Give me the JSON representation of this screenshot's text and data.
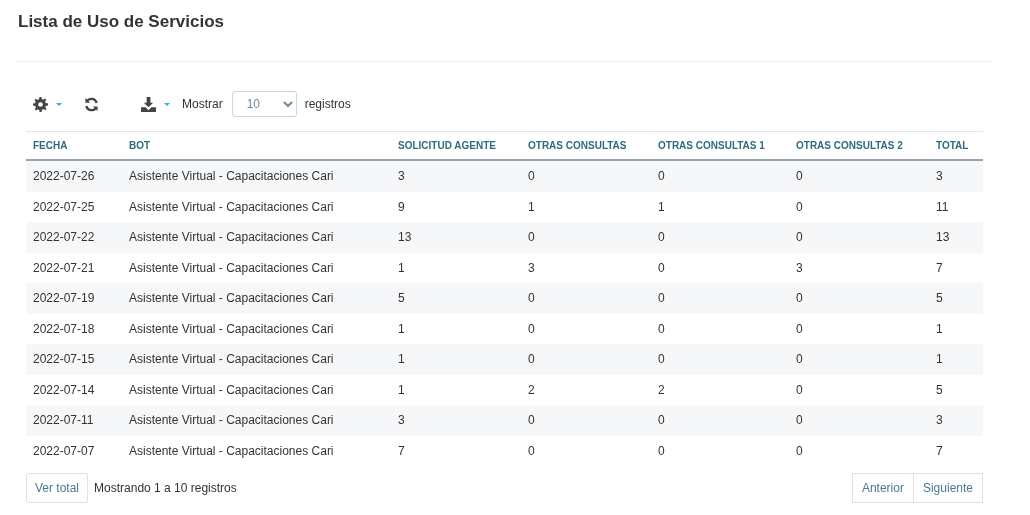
{
  "page": {
    "title": "Lista de Uso de Servicios"
  },
  "toolbar": {
    "show_label": "Mostrar",
    "page_size": "10",
    "records_label": "registros"
  },
  "table": {
    "columns": [
      "FECHA",
      "BOT",
      "SOLICITUD AGENTE",
      "OTRAS CONSULTAS",
      "OTRAS CONSULTAS 1",
      "OTRAS CONSULTAS 2",
      "TOTAL"
    ],
    "rows": [
      [
        "2022-07-26",
        "Asistente Virtual - Capacitaciones Cari",
        "3",
        "0",
        "0",
        "0",
        "3"
      ],
      [
        "2022-07-25",
        "Asistente Virtual - Capacitaciones Cari",
        "9",
        "1",
        "1",
        "0",
        "11"
      ],
      [
        "2022-07-22",
        "Asistente Virtual - Capacitaciones Cari",
        "13",
        "0",
        "0",
        "0",
        "13"
      ],
      [
        "2022-07-21",
        "Asistente Virtual - Capacitaciones Cari",
        "1",
        "3",
        "0",
        "3",
        "7"
      ],
      [
        "2022-07-19",
        "Asistente Virtual - Capacitaciones Cari",
        "5",
        "0",
        "0",
        "0",
        "5"
      ],
      [
        "2022-07-18",
        "Asistente Virtual - Capacitaciones Cari",
        "1",
        "0",
        "0",
        "0",
        "1"
      ],
      [
        "2022-07-15",
        "Asistente Virtual - Capacitaciones Cari",
        "1",
        "0",
        "0",
        "0",
        "1"
      ],
      [
        "2022-07-14",
        "Asistente Virtual - Capacitaciones Cari",
        "1",
        "2",
        "2",
        "0",
        "5"
      ],
      [
        "2022-07-11",
        "Asistente Virtual - Capacitaciones Cari",
        "3",
        "0",
        "0",
        "0",
        "3"
      ],
      [
        "2022-07-07",
        "Asistente Virtual - Capacitaciones Cari",
        "7",
        "0",
        "0",
        "0",
        "7"
      ]
    ]
  },
  "footer": {
    "view_all": "Ver total",
    "summary": "Mostrando 1 a 10 registros",
    "pagination": [
      "Anterior",
      "Siguiente"
    ]
  }
}
